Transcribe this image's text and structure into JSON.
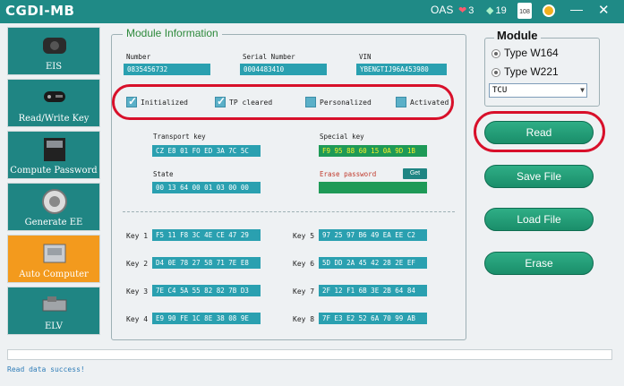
{
  "app": {
    "title": "CGDI-MB"
  },
  "titlebar": {
    "oas": "OAS",
    "hearts": "3",
    "gems": "19",
    "calendar": "108"
  },
  "nav": [
    {
      "label": "EIS",
      "icon": "eis-icon"
    },
    {
      "label": "Read/Write Key",
      "icon": "key-icon"
    },
    {
      "label": "Compute Password",
      "icon": "calculator-icon"
    },
    {
      "label": "Generate EE",
      "icon": "gear-icon"
    },
    {
      "label": "Auto Computer",
      "icon": "ecu-icon"
    },
    {
      "label": "ELV",
      "icon": "elv-icon"
    }
  ],
  "module_info": {
    "legend": "Module Information",
    "number_label": "Number",
    "number": "0835456732",
    "serial_label": "Serial Number",
    "serial": "0004483410",
    "vin_label": "VIN",
    "vin": "YBENGTIJ96A453980",
    "checks": [
      {
        "label": "Initialized",
        "checked": true
      },
      {
        "label": "TP cleared",
        "checked": true
      },
      {
        "label": "Personalized",
        "checked": false
      },
      {
        "label": "Activated",
        "checked": false
      }
    ],
    "transport_label": "Transport key",
    "transport": "CZ E8 01 FO ED 3A 7C 5C",
    "special_label": "Special key",
    "special": "F9 95 88 60 15 0A 9D 1B",
    "state_label": "State",
    "state": "00 13 64 00 01 03 00 00",
    "erase_label": "Erase password",
    "erase": "",
    "get_label": "Get"
  },
  "keys": [
    {
      "label": "Key 1",
      "value": "F5 11 F8 3C 4E CE 47 29"
    },
    {
      "label": "Key 2",
      "value": "D4 0E 78 27 58 71 7E E8"
    },
    {
      "label": "Key 3",
      "value": "7E C4 5A 55 82 82 7B D3"
    },
    {
      "label": "Key 4",
      "value": "E9 90 FE 1C 8E 38 08 9E"
    },
    {
      "label": "Key 5",
      "value": "97 25 97 B6 49 EA EE C2"
    },
    {
      "label": "Key 6",
      "value": "5D DD 2A 45 42 28 2E EF"
    },
    {
      "label": "Key 7",
      "value": "2F 12 F1 6B 3E 2B 64 84"
    },
    {
      "label": "Key 8",
      "value": "7F E3 E2 52 6A 70 99 AB"
    }
  ],
  "module": {
    "title": "Module",
    "options": [
      {
        "label": "Type W164",
        "selected": false
      },
      {
        "label": "Type W221",
        "selected": false
      }
    ],
    "select_value": "TCU"
  },
  "buttons": {
    "read": "Read",
    "save": "Save File",
    "load": "Load File",
    "erase": "Erase"
  },
  "status": {
    "text": "Read data success!"
  }
}
